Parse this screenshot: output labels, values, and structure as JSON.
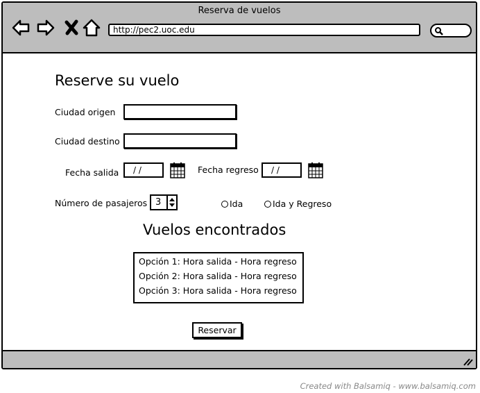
{
  "window": {
    "title": "Reserva de vuelos"
  },
  "browser": {
    "url": "http://pec2.uoc.edu",
    "icons": [
      "back-arrow-icon",
      "forward-arrow-icon",
      "close-x-icon",
      "home-icon",
      "search-icon"
    ]
  },
  "form": {
    "title": "Reserve su vuelo",
    "origin_label": "Ciudad origen",
    "origin_value": "",
    "destination_label": "Ciudad destino",
    "destination_value": "",
    "departure_label": "Fecha salida",
    "departure_value": "/ /",
    "return_label": "Fecha regreso",
    "return_value": "/ /",
    "passengers_label": "Número de pasajeros",
    "passengers_value": "3",
    "trip_options": [
      "Ida",
      "Ida y Regreso"
    ]
  },
  "results": {
    "title": "Vuelos encontrados",
    "options": [
      "Opción 1: Hora salida - Hora regreso",
      "Opción 2: Hora salida - Hora regreso",
      "Opción 3: Hora salida - Hora regreso"
    ],
    "button_label": "Reservar"
  },
  "credit": "Created with Balsamiq - www.balsamiq.com"
}
